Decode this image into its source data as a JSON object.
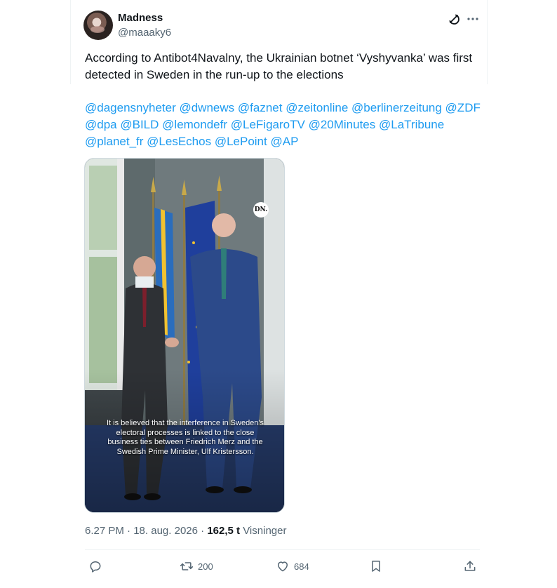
{
  "author": {
    "display_name": "Madness",
    "handle": "@maaaky6"
  },
  "tweet": {
    "text": "According to Antibot4Navalny, the Ukrainian botnet ‘Vyshyvanka’ was first detected in Sweden in the run-up to the elections",
    "mentions": [
      "@dagensnyheter",
      "@dwnews",
      "@faznet",
      "@zeitonline",
      "@berlinerzeitung",
      "@ZDF",
      "@dpa",
      "@BILD",
      "@lemondefr",
      "@LeFigaroTV",
      "@20Minutes",
      "@LaTribune",
      "@planet_fr",
      "@LesEchos",
      "@LePoint",
      "@AP"
    ],
    "media": {
      "logo_text": "DN.",
      "caption": "It is believed that the interference in Sweden's electoral processes is linked to the close business ties between Friedrich Merz and the Swedish Prime Minister, Ulf Kristersson."
    }
  },
  "meta": {
    "time": "6.27 PM",
    "separator": " · ",
    "date": "18. aug. 2026",
    "views_count": "162,5 t",
    "views_label": "Visninger"
  },
  "actions": {
    "reply_count": "",
    "retweet_count": "200",
    "like_count": "684"
  },
  "icons": {
    "grok": "grok-icon",
    "more": "more-icon",
    "reply": "reply-icon",
    "retweet": "retweet-icon",
    "like": "heart-icon",
    "bookmark": "bookmark-icon",
    "share": "share-icon"
  },
  "colors": {
    "text": "#0f1419",
    "secondary": "#536471",
    "link": "#1d9bf0",
    "border": "#eff3f4"
  }
}
